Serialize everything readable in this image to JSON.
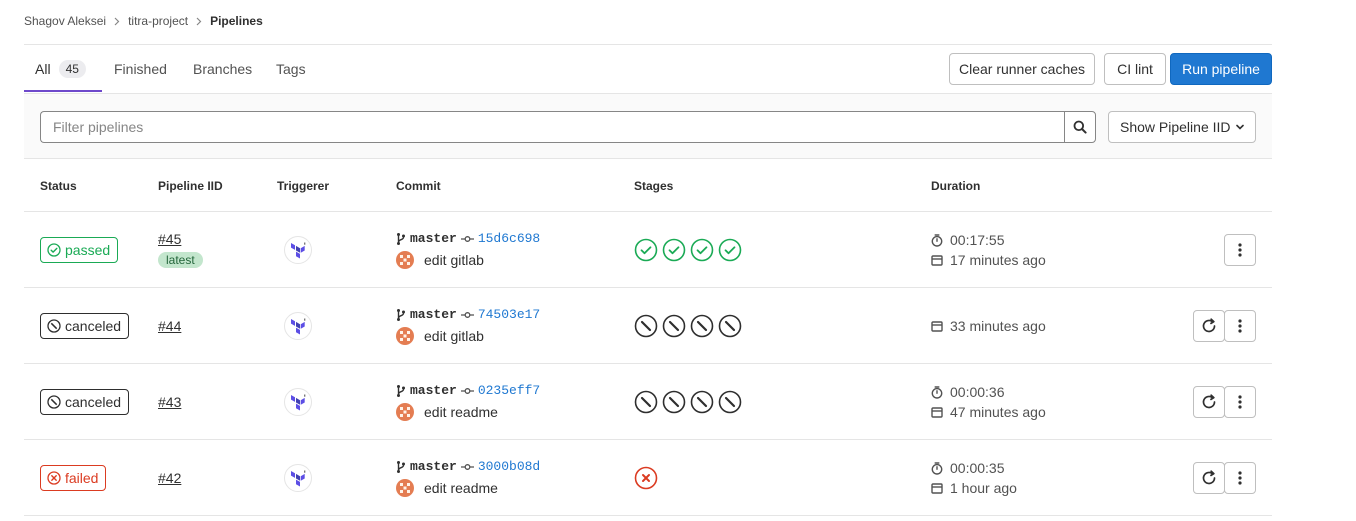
{
  "breadcrumb": {
    "items": [
      "Shagov Aleksei",
      "titra-project"
    ],
    "current": "Pipelines"
  },
  "tabs": [
    {
      "label": "All",
      "count": "45"
    },
    {
      "label": "Finished"
    },
    {
      "label": "Branches"
    },
    {
      "label": "Tags"
    }
  ],
  "actions": {
    "clear_caches": "Clear runner caches",
    "ci_lint": "CI lint",
    "run_pipeline": "Run pipeline"
  },
  "filter": {
    "placeholder": "Filter pipelines",
    "dropdown_label": "Show Pipeline IID"
  },
  "table": {
    "headers": [
      "Status",
      "Pipeline IID",
      "Triggerer",
      "Commit",
      "Stages",
      "Duration"
    ],
    "rows": [
      {
        "status": "passed",
        "iid": "#45",
        "tag": "latest",
        "branch": "master",
        "sha": "15d6c698",
        "message": "edit gitlab",
        "stages": [
          "success",
          "success",
          "success",
          "success"
        ],
        "duration": "00:17:55",
        "finished": "17 minutes ago"
      },
      {
        "status": "canceled",
        "iid": "#44",
        "branch": "master",
        "sha": "74503e17",
        "message": "edit gitlab",
        "stages": [
          "canceled",
          "canceled",
          "canceled",
          "canceled"
        ],
        "finished": "33 minutes ago"
      },
      {
        "status": "canceled",
        "iid": "#43",
        "branch": "master",
        "sha": "0235eff7",
        "message": "edit readme",
        "stages": [
          "canceled",
          "canceled",
          "canceled",
          "canceled"
        ],
        "duration": "00:00:36",
        "finished": "47 minutes ago"
      },
      {
        "status": "failed",
        "iid": "#42",
        "branch": "master",
        "sha": "3000b08d",
        "message": "edit readme",
        "stages": [
          "failed"
        ],
        "duration": "00:00:35",
        "finished": "1 hour ago"
      }
    ]
  },
  "colors": {
    "success": "#1aaa55",
    "canceled": "#2e2e2e",
    "failed": "#db3b21",
    "primary": "#1f78d1",
    "tab_underline": "#6e49cb"
  },
  "icons": {
    "status_passed": "check-circle-icon",
    "status_canceled": "cancel-circle-icon",
    "status_failed": "close-circle-icon",
    "retry": "retry-icon",
    "more_actions": "ellipsis-v-icon",
    "timer": "timer-icon",
    "calendar": "calendar-icon",
    "branch": "branch-icon",
    "commit": "commit-icon",
    "search": "search-icon"
  }
}
